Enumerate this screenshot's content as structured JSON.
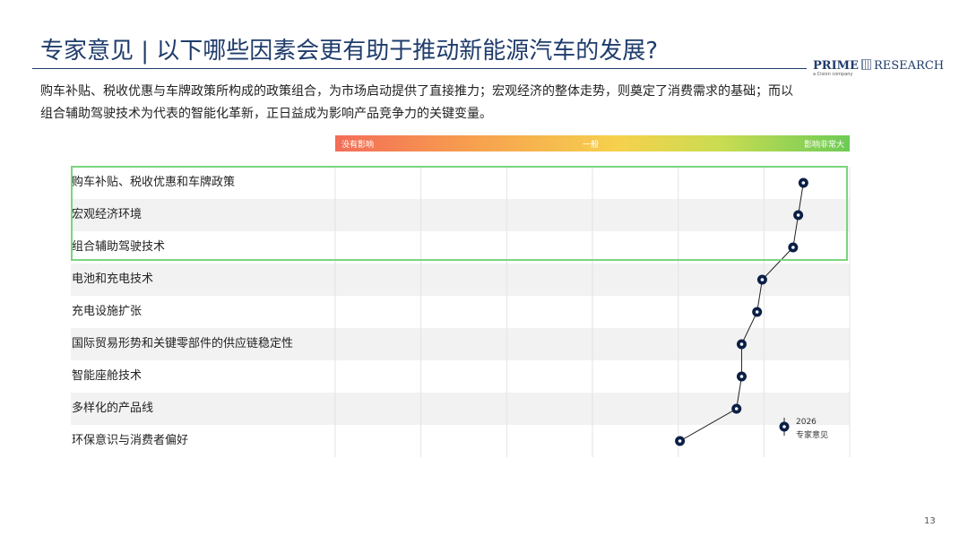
{
  "slide": {
    "title": "专家意见 | 以下哪些因素会更有助于推动新能源汽车的发展?",
    "description": "购车补贴、税收优惠与车牌政策所构成的政策组合，为市场启动提供了直接推力；宏观经济的整体走势，则奠定了消费需求的基础；而以组合辅助驾驶技术为代表的智能化革新，正日益成为影响产品竞争力的关键变量。",
    "page_number": "13"
  },
  "logo": {
    "brand_bold": "PRIME",
    "brand_light": "RESEARCH",
    "tagline": "a Cision company"
  },
  "scale": {
    "low_label": "没有影响",
    "mid_label": "一般",
    "high_label": "影响非常大"
  },
  "legend": {
    "year": "2026",
    "label": "专家意见"
  },
  "colors": {
    "title": "#1f3c6b",
    "marker": "#0b1f45",
    "highlight_border": "#7bd47d",
    "row_stripe": "#f2f2f2"
  },
  "chart_data": {
    "type": "scatter",
    "title": "",
    "xlabel": "",
    "ylabel": "",
    "xlim": [
      0,
      10
    ],
    "scale_labels": [
      "没有影响",
      "一般",
      "影响非常大"
    ],
    "grid": true,
    "legend_position": "bottom-right",
    "categories": [
      "购车补贴、税收优惠和车牌政策",
      "宏观经济环境",
      "组合辅助驾驶技术",
      "电池和充电技术",
      "充电设施扩张",
      "国际贸易形势和关键零部件的供应链稳定性",
      "智能座舱技术",
      "多样化的产品线",
      "环保意识与消费者偏好"
    ],
    "series": [
      {
        "name": "2026 专家意见",
        "values": [
          9.1,
          9.0,
          8.9,
          8.3,
          8.2,
          7.9,
          7.9,
          7.8,
          6.7
        ]
      }
    ],
    "highlighted": [
      "购车补贴、税收优惠和车牌政策",
      "宏观经济环境",
      "组合辅助驾驶技术"
    ]
  }
}
